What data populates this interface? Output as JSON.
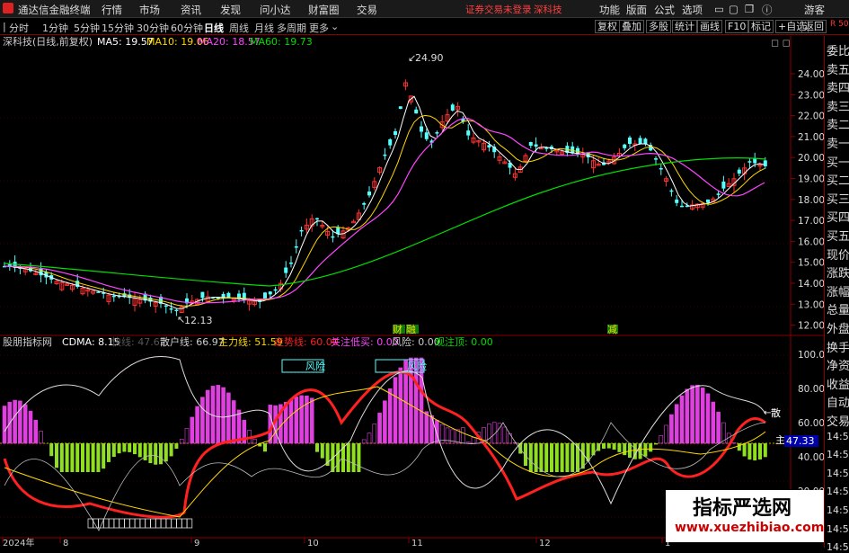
{
  "menubar": {
    "app_title": "通达信金融终端",
    "menus": [
      "行情",
      "市场",
      "资讯",
      "发现",
      "问小达",
      "财富圈",
      "交易"
    ],
    "notice": "证券交易未登录",
    "notice_stock": "深科技",
    "right_menus": [
      "功能",
      "版面",
      "公式",
      "选项"
    ],
    "guest": "游客"
  },
  "toolbar": {
    "periods": [
      "分时",
      "1分钟",
      "5分钟",
      "15分钟",
      "30分钟",
      "60分钟",
      "日线",
      "周线",
      "月线",
      "多周期",
      "更多"
    ],
    "active_period": "日线",
    "right_buttons": [
      "复权",
      "叠加",
      "多股",
      "统计",
      "画线",
      "F10",
      "标记",
      "+自选",
      "返回"
    ]
  },
  "main_header": {
    "stock": "深科技(日线,前复权)",
    "ma5": "MA5: 19.57",
    "ma10": "MA10: 19.06",
    "ma20": "MA20: 18.57",
    "ma60": "MA60: 19.73"
  },
  "price_chart": {
    "high_label": "24.90",
    "low_label": "12.13",
    "axis": [
      "24.00",
      "23.00",
      "22.00",
      "21.00",
      "20.00",
      "19.00",
      "18.00",
      "17.00",
      "16.00",
      "15.00",
      "14.00",
      "13.00",
      "12.00"
    ],
    "markers": [
      "财",
      "融",
      "减"
    ]
  },
  "indicator_header": {
    "name": "股朋指标网",
    "cdma": "CDMA: 8.15",
    "fast": "快线: 47.62",
    "retail": "散户线: 66.97",
    "main": "主力线: 51.59",
    "trend": "走势线: 60.00",
    "attention": "关注低买: 0.00",
    "risk": "风险: 0.00",
    "watch_top": "观注顶: 0.00"
  },
  "indicator": {
    "axis": [
      "100.0",
      "80.00",
      "60.00",
      "40.00",
      "20.00"
    ],
    "risk_labels": [
      "风险",
      "风险"
    ],
    "tag_retail": "散",
    "tag_main": "主",
    "value_box": "47.33"
  },
  "x_axis": {
    "labels": [
      "2024年",
      "8",
      "9",
      "10",
      "11",
      "12",
      "1"
    ]
  },
  "sidebar": {
    "top": "R 500",
    "items": [
      "委比",
      "卖五",
      "卖四",
      "卖三",
      "卖二",
      "卖一",
      "买一",
      "买二",
      "买三",
      "买四",
      "买五",
      "现价",
      "涨跌",
      "涨幅",
      "总量",
      "外盘",
      "换手",
      "净资",
      "收益",
      "自动",
      "交易",
      "14:56",
      "14:56",
      "14:56",
      "14:56",
      "14:56",
      "14:56",
      "14:56"
    ]
  },
  "watermark": {
    "title": "指标严选网",
    "url": "www.xuezhibiao.com"
  },
  "colors": {
    "up": "#ff3232",
    "down": "#54ffff",
    "ma5": "#ffffff",
    "ma10": "#ffd700",
    "ma20": "#ff44ff",
    "ma60": "#00dd00",
    "trend": "#ff2020",
    "bars_up": "#e040e0",
    "bars_down": "#90e020"
  }
}
